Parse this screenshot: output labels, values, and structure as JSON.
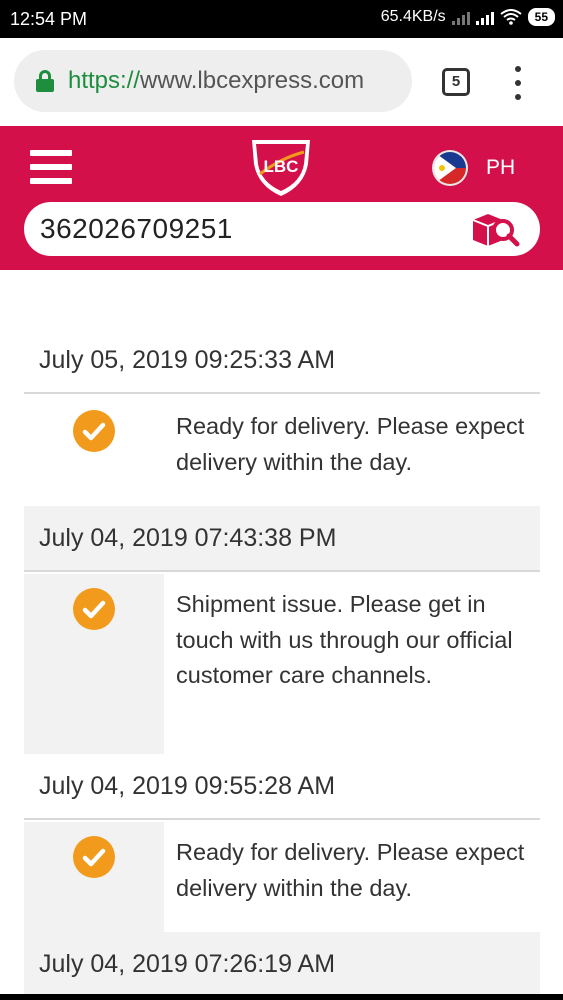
{
  "status_bar": {
    "time": "12:54 PM",
    "speed": "65.4KB/s",
    "battery": "55"
  },
  "browser": {
    "url_scheme": "https://",
    "url_host": "www.lbcexpress.com",
    "tab_count": "5"
  },
  "header": {
    "logo_text": "LBC",
    "country": "PH",
    "tracking_number": "362026709251",
    "brand_color": "#d3104a",
    "accent_color": "#f29a1b"
  },
  "timeline": [
    {
      "date": "July 05, 2019 09:25:33 AM",
      "status": "Ready for delivery. Please expect delivery within the day."
    },
    {
      "date": "July 04, 2019 07:43:38 PM",
      "status": "Shipment issue. Please get in touch with us through our official customer care channels."
    },
    {
      "date": "July 04, 2019 09:55:28 AM",
      "status": "Ready for delivery. Please expect delivery within the day."
    },
    {
      "date": "July 04, 2019 07:26:19 AM",
      "status": ""
    }
  ]
}
